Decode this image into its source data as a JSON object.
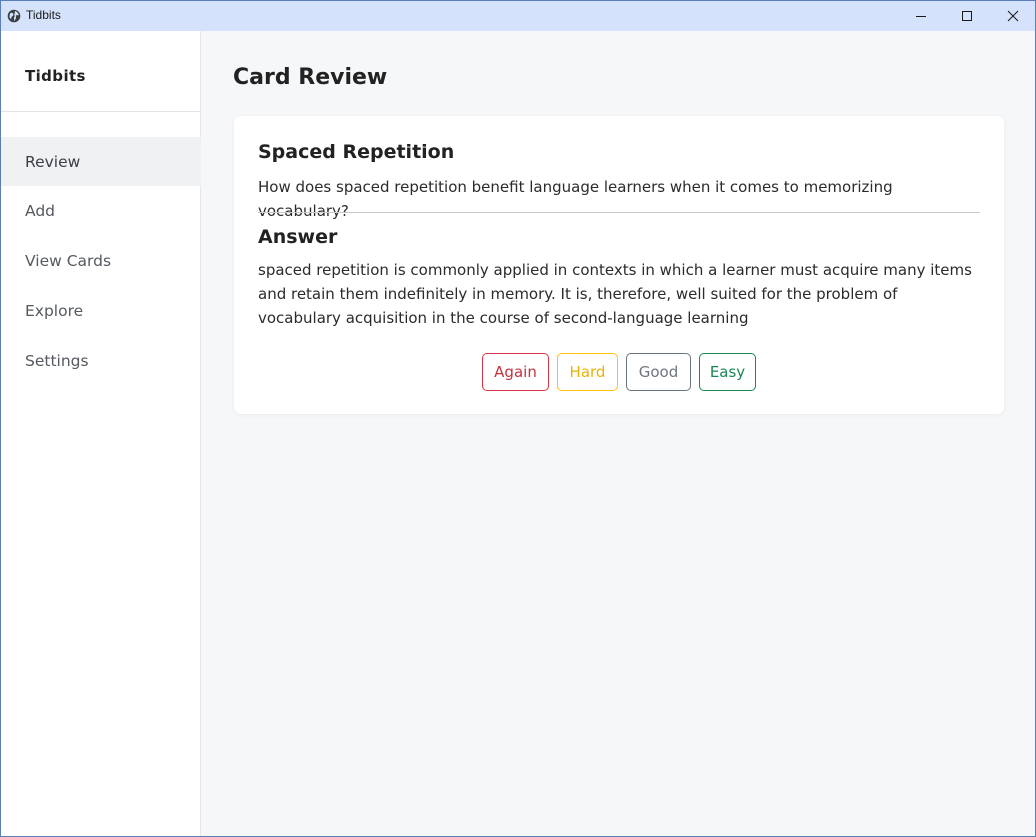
{
  "window": {
    "title": "Tidbits",
    "app_icon": "globe-icon",
    "controls": [
      "minimize-icon",
      "maximize-icon",
      "close-icon"
    ]
  },
  "sidebar": {
    "brand": "Tidbits",
    "items": [
      {
        "label": "Review",
        "active": true
      },
      {
        "label": "Add",
        "active": false
      },
      {
        "label": "View Cards",
        "active": false
      },
      {
        "label": "Explore",
        "active": false
      },
      {
        "label": "Settings",
        "active": false
      }
    ]
  },
  "main": {
    "page_title": "Card Review",
    "card": {
      "question_title": "Spaced Repetition",
      "question_text": "How does spaced repetition benefit language learners when it comes to memorizing vocabulary?",
      "answer_title": "Answer",
      "answer_text": "spaced repetition is commonly applied in contexts in which a learner must acquire many items and retain them indefinitely in memory. It is, therefore, well suited for the problem of vocabulary acquisition in the course of second-language learning",
      "buttons": {
        "again": "Again",
        "hard": "Hard",
        "good": "Good",
        "easy": "Easy"
      }
    }
  },
  "colors": {
    "titlebar": "#d4e3fb",
    "again": "#dc3545",
    "hard": "#ffc107",
    "good": "#6c757d",
    "easy": "#198754"
  }
}
